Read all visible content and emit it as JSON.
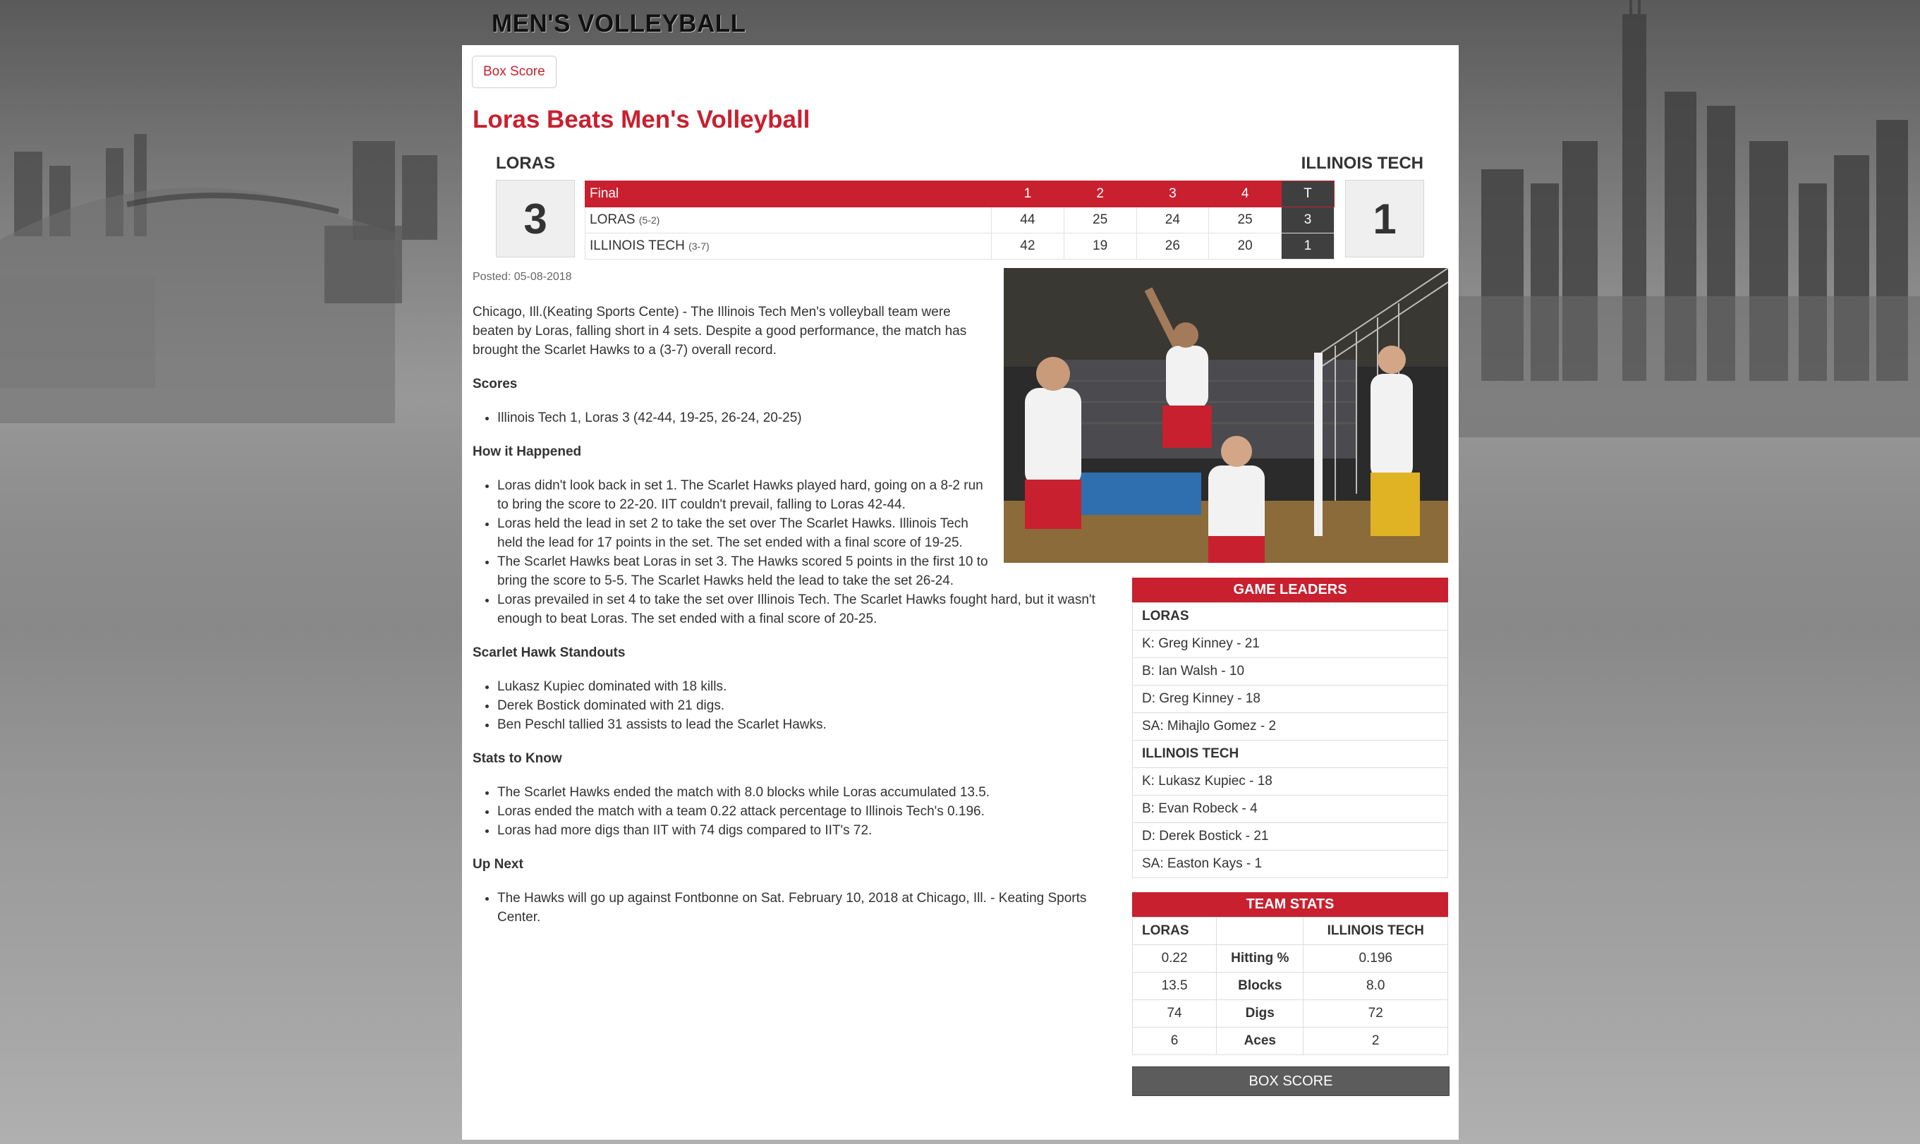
{
  "site": {
    "title": "MEN'S VOLLEYBALL"
  },
  "nav": {
    "box_score_tab": "Box Score"
  },
  "headline": "Loras Beats Men's Volleyball",
  "linescore": {
    "away": {
      "name": "LORAS",
      "score": "3"
    },
    "home": {
      "name": "ILLINOIS TECH",
      "score": "1"
    },
    "header": [
      "Final",
      "1",
      "2",
      "3",
      "4",
      "T"
    ],
    "rows": [
      {
        "team": "LORAS",
        "record": "(5-2)",
        "sets": [
          "44",
          "25",
          "24",
          "25"
        ],
        "total": "3"
      },
      {
        "team": "ILLINOIS TECH",
        "record": "(3-7)",
        "sets": [
          "42",
          "19",
          "26",
          "20"
        ],
        "total": "1"
      }
    ]
  },
  "article": {
    "posted": "Posted: 05-08-2018",
    "intro": "Chicago, Ill.(Keating Sports Cente) - The Illinois Tech Men's volleyball team were beaten by Loras, falling short in 4 sets. Despite a good performance, the match has brought the Scarlet Hawks to a (3-7) overall record.",
    "sections": [
      {
        "title": "Scores",
        "items": [
          "Illinois Tech 1, Loras 3 (42-44, 19-25, 26-24, 20-25)"
        ]
      },
      {
        "title": "How it Happened",
        "items": [
          "Loras didn't look back in set 1. The Scarlet Hawks played hard, going on a 8-2 run to bring the score to 22-20. IIT couldn't prevail, falling to Loras 42-44.",
          "Loras held the lead in set 2 to take the set over The Scarlet Hawks. Illinois Tech held the lead for 17 points in the set. The set ended with a final score of 19-25.",
          "The Scarlet Hawks beat Loras in set 3. The Hawks scored 5 points in the first 10 to bring the score to 5-5. The Scarlet Hawks held the lead to take the set 26-24.",
          "Loras prevailed in set 4 to take the set over Illinois Tech. The Scarlet Hawks fought hard, but it wasn't enough to beat Loras. The set ended with a final score of 20-25."
        ]
      },
      {
        "title": "Scarlet Hawk Standouts",
        "items": [
          "Lukasz Kupiec dominated with 18 kills.",
          "Derek Bostick dominated with 21 digs.",
          "Ben Peschl tallied 31 assists to lead the Scarlet Hawks."
        ]
      },
      {
        "title": "Stats to Know",
        "items": [
          "The Scarlet Hawks ended the match with 8.0 blocks while Loras accumulated 13.5.",
          "Loras ended the match with a team 0.22 attack percentage to Illinois Tech's 0.196.",
          "Loras had more digs than IIT with 74 digs compared to IIT's 72."
        ]
      },
      {
        "title": "Up Next",
        "items": [
          "The Hawks will go up against Fontbonne on Sat. February 10, 2018 at Chicago, Ill. - Keating Sports Center."
        ]
      }
    ]
  },
  "game_leaders": {
    "title": "GAME LEADERS",
    "groups": [
      {
        "team": "LORAS",
        "entries": [
          "K: Greg Kinney - 21",
          "B: Ian Walsh - 10",
          "D: Greg Kinney - 18",
          "SA: Mihajlo Gomez - 2"
        ]
      },
      {
        "team": "ILLINOIS TECH",
        "entries": [
          "K: Lukasz Kupiec - 18",
          "B: Evan Robeck - 4",
          "D: Derek Bostick - 21",
          "SA: Easton Kays - 1"
        ]
      }
    ]
  },
  "team_stats": {
    "title": "TEAM STATS",
    "away": "LORAS",
    "home": "ILLINOIS TECH",
    "rows": [
      {
        "label": "Hitting %",
        "away": "0.22",
        "home": "0.196"
      },
      {
        "label": "Blocks",
        "away": "13.5",
        "home": "8.0"
      },
      {
        "label": "Digs",
        "away": "74",
        "home": "72"
      },
      {
        "label": "Aces",
        "away": "6",
        "home": "2"
      }
    ]
  },
  "box_score_button": "BOX SCORE",
  "colors": {
    "accent": "#c8202f",
    "dark": "#3f3f3f",
    "button": "#5c5c5c"
  }
}
